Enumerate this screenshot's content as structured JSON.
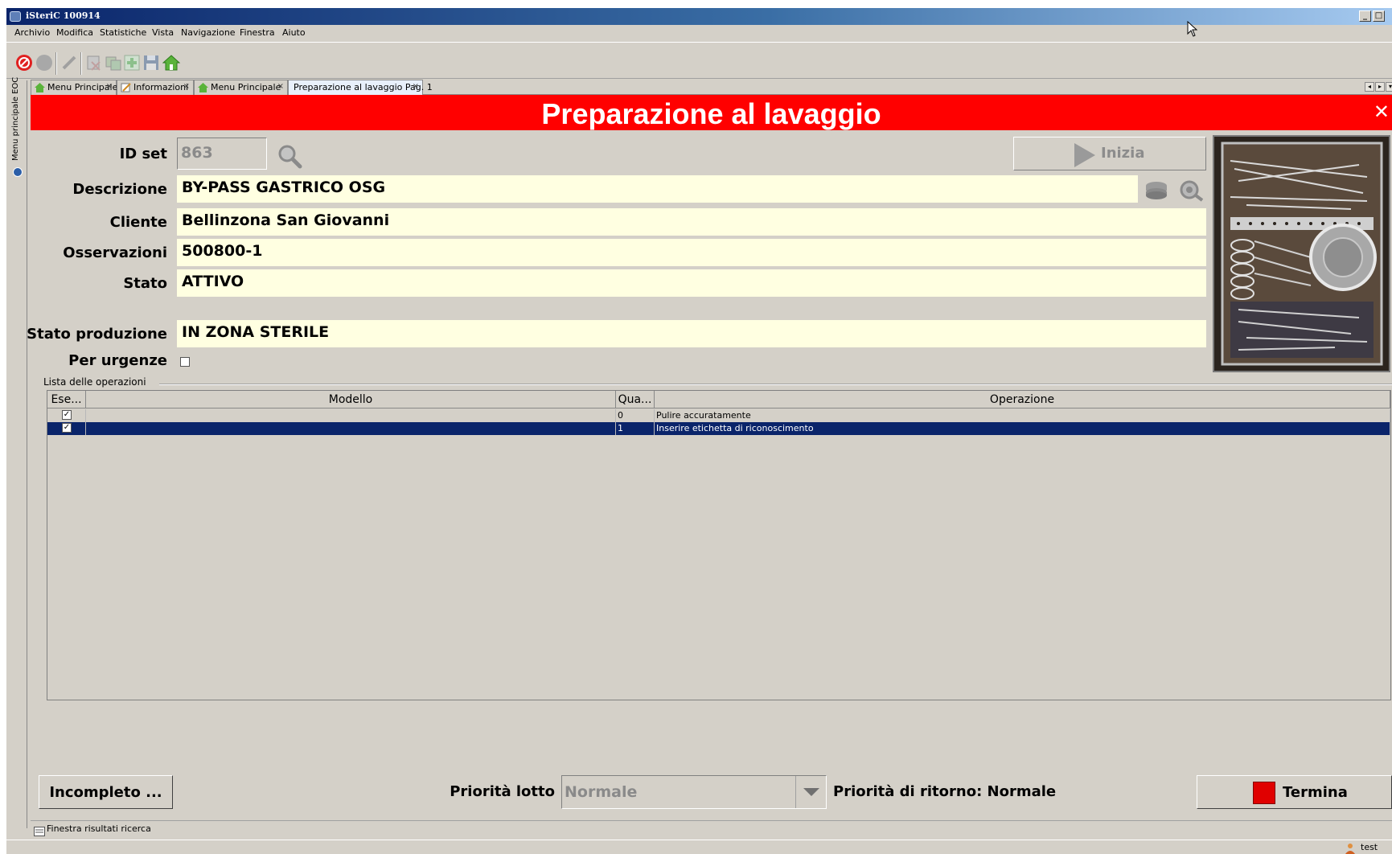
{
  "window": {
    "title": "iSteriC 100914"
  },
  "menu": [
    "Archivio",
    "Modifica",
    "Statistiche",
    "Vista",
    "Navigazione",
    "Finestra",
    "Aiuto"
  ],
  "side_tab": {
    "label": "Menu principale EOC"
  },
  "tabs": [
    {
      "label": "Menu Principale",
      "icon": "home-icon"
    },
    {
      "label": "Informazioni",
      "icon": "edit-icon"
    },
    {
      "label": "Menu Principale",
      "icon": "home-icon"
    },
    {
      "label": "Preparazione al lavaggio Pag. 1",
      "icon": "",
      "active": true
    }
  ],
  "header": {
    "title": "Preparazione al lavaggio"
  },
  "form": {
    "id_set_label": "ID set",
    "id_set_value": "863",
    "descrizione_label": "Descrizione",
    "descrizione_value": "BY-PASS GASTRICO OSG",
    "cliente_label": "Cliente",
    "cliente_value": "Bellinzona San Giovanni",
    "osservazioni_label": "Osservazioni",
    "osservazioni_value": "500800-1",
    "stato_label": "Stato",
    "stato_value": "ATTIVO",
    "stato_produzione_label": "Stato produzione",
    "stato_produzione_value": "IN ZONA STERILE",
    "per_urgenze_label": "Per urgenze",
    "per_urgenze_checked": false
  },
  "inizia_button": {
    "label": "Inizia"
  },
  "operations": {
    "group_title": "Lista delle operazioni",
    "columns": [
      "Ese...",
      "Modello",
      "Qua...",
      "Operazione"
    ],
    "rows": [
      {
        "eseguito": "✓",
        "modello": "",
        "quantita": "0",
        "operazione": "Pulire accuratamente"
      },
      {
        "eseguito": "✓",
        "modello": "",
        "quantita": "1",
        "operazione": "Inserire etichetta di riconoscimento"
      }
    ]
  },
  "footer": {
    "incompleto_label": "Incompleto ...",
    "priorita_lotto_label": "Priorità lotto",
    "priorita_lotto_value": "Normale",
    "priorita_ritorno": "Priorità di ritorno: Normale",
    "termina_label": "Termina"
  },
  "status": {
    "search_results": "Finestra risultati ricerca",
    "user": "test"
  },
  "colors": {
    "header_red": "#ff0000",
    "field_bg": "#ffffe1",
    "selection": "#0a246a",
    "termina_red": "#e00000"
  }
}
